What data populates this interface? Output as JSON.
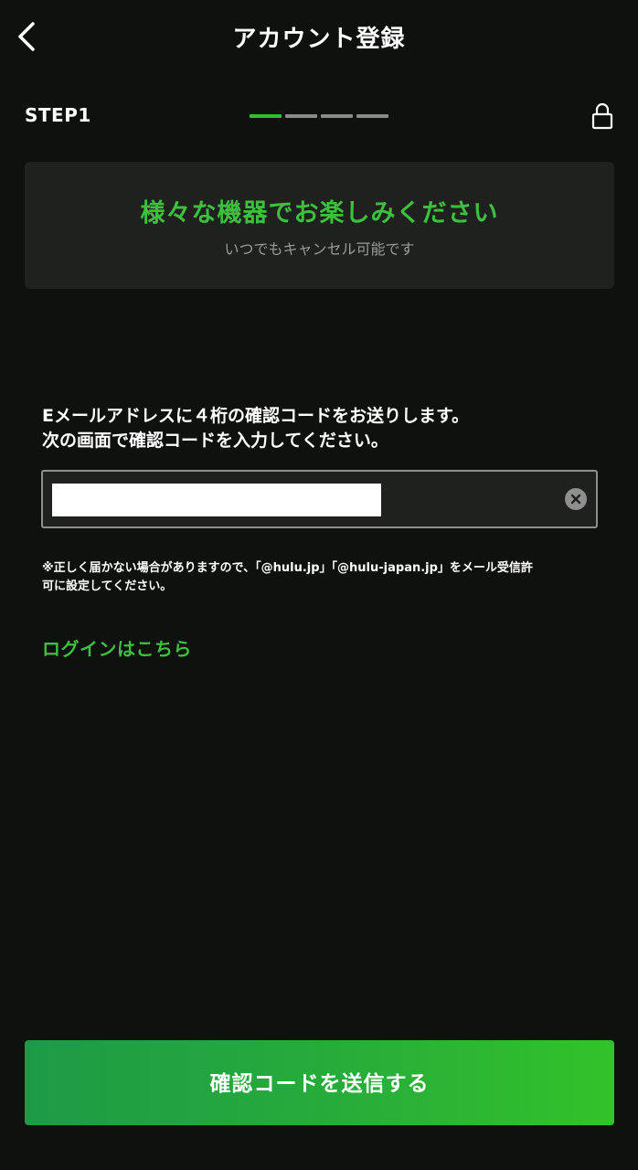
{
  "header": {
    "title": "アカウント登録",
    "back_icon": "chevron-left-icon"
  },
  "step": {
    "label": "STEP1",
    "current": 1,
    "total": 4,
    "colors": {
      "active": "#2ec12e",
      "inactive": "#8a8a8a"
    },
    "lock_icon": "lock-icon"
  },
  "banner": {
    "title": "様々な機器でお楽しみください",
    "subtitle": "いつでもキャンセル可能です",
    "title_color": "#3fbf3f"
  },
  "instruction": {
    "line1": "Eメールアドレスに４桁の確認コードをお送りします。",
    "line2": "次の画面で確認コードを入力してください。"
  },
  "email": {
    "value": "",
    "clear_icon": "clear-circle-x-icon"
  },
  "notice": {
    "line1": "※正しく届かない場合がありますので、「@hulu.jp」「@hulu-japan.jp」をメール受信許",
    "line2": "可に設定してください。"
  },
  "login_link": {
    "label": "ログインはこちら"
  },
  "submit": {
    "label": "確認コードを送信する",
    "color_start": "#1e9a46",
    "color_end": "#33c22a"
  }
}
